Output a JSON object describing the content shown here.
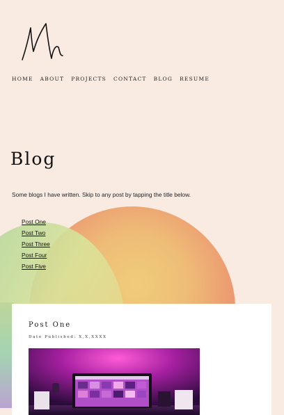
{
  "nav": {
    "items": [
      "HOME",
      "ABOUT",
      "PROJECTS",
      "CONTACT",
      "BLOG",
      "RESUME"
    ]
  },
  "blog": {
    "title": "Blog",
    "intro": "Some blogs I have written. Skip to any post by tapping the title below.",
    "posts": [
      "Post One",
      "Post Two",
      "Post Three",
      "Post Four",
      "Post Five"
    ]
  },
  "card": {
    "title": "Post One",
    "date": "Date Published: X,X,XXXX"
  },
  "colors": {
    "background": "#f9ebe2",
    "card": "#ffffff",
    "text": "#1a1a1a"
  }
}
